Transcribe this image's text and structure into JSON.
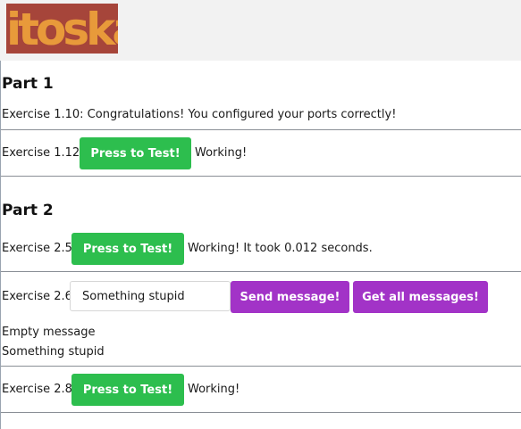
{
  "logo": {
    "text": "itoska"
  },
  "part1": {
    "title": "Part 1",
    "ex110": "Exercise 1.10: Congratulations! You configured your ports correctly!",
    "ex112": {
      "label": "Exercise 1.12:",
      "button": "Press to Test!",
      "status": "Working!"
    }
  },
  "part2": {
    "title": "Part 2",
    "ex25": {
      "label": "Exercise 2.5:",
      "button": "Press to Test!",
      "status": "Working! It took 0.012 seconds."
    },
    "ex26": {
      "label": "Exercise 2.6:",
      "input_value": "Something stupid",
      "send_button": "Send message!",
      "get_button": "Get all messages!",
      "messages": [
        "Empty message",
        "Something stupid"
      ]
    },
    "ex28": {
      "label": "Exercise 2.8:",
      "button": "Press to Test!",
      "status": "Working!"
    }
  },
  "colors": {
    "green": "#2dbe4e",
    "purple": "#a233c7",
    "logo_bg": "#a6453a",
    "logo_fg": "#e89a3a"
  }
}
